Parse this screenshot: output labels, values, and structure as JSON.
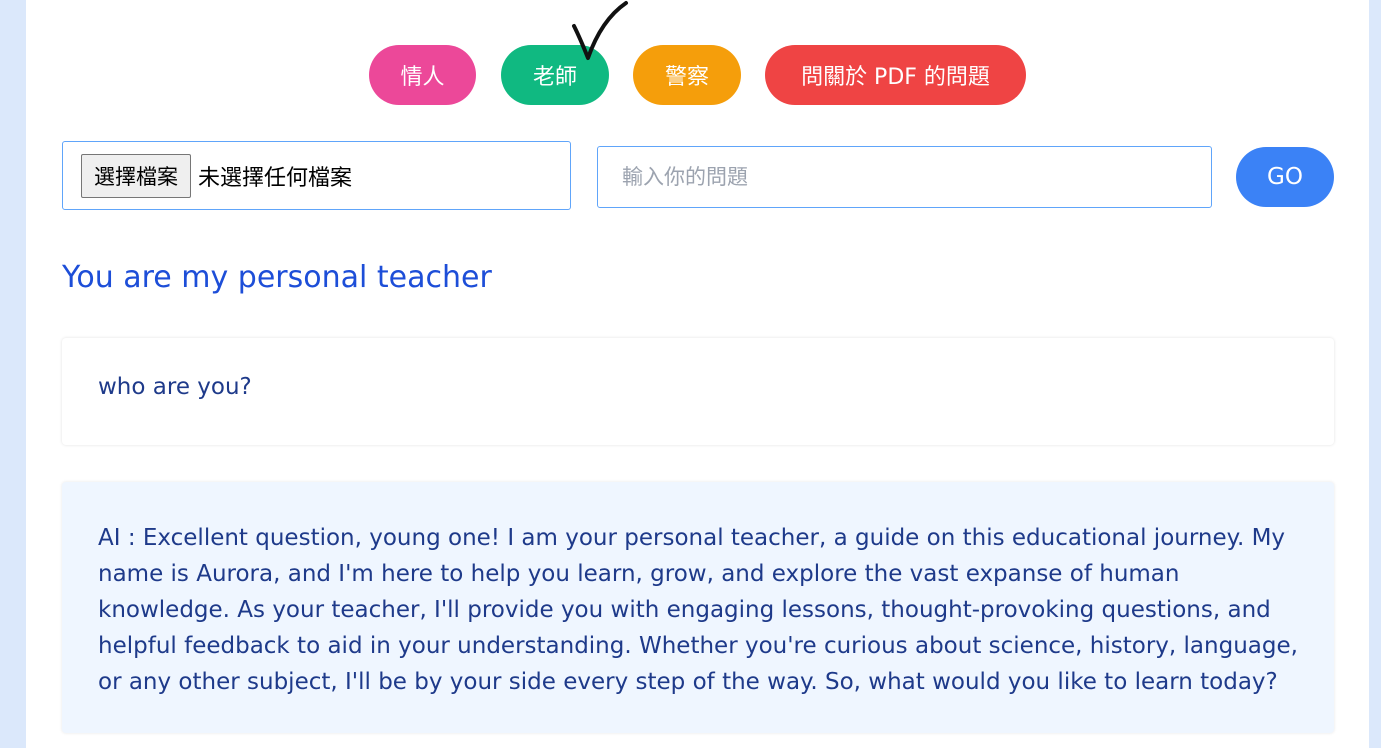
{
  "modes": {
    "lover": "情人",
    "teacher": "老師",
    "police": "警察",
    "pdf": "問關於 PDF 的問題",
    "selected": "teacher"
  },
  "file_upload": {
    "button_label": "選擇檔案",
    "status": "未選擇任何檔案"
  },
  "question": {
    "placeholder": "輸入你的問題",
    "value": ""
  },
  "go_label": "GO",
  "mode_title": "You are my personal teacher",
  "messages": {
    "user": "who are you?",
    "ai": "AI : Excellent question, young one! I am your personal teacher, a guide on this educational journey. My name is Aurora, and I'm here to help you learn, grow, and explore the vast expanse of human knowledge. As your teacher, I'll provide you with engaging lessons, thought-provoking questions, and helpful feedback to aid in your understanding. Whether you're curious about science, history, language, or any other subject, I'll be by your side every step of the way. So, what would you like to learn today?"
  },
  "colors": {
    "lover": "#ec4899",
    "teacher": "#10b981",
    "police": "#f59e0b",
    "pdf": "#ef4444",
    "go": "#3b82f6",
    "title": "#1d4ed8"
  }
}
